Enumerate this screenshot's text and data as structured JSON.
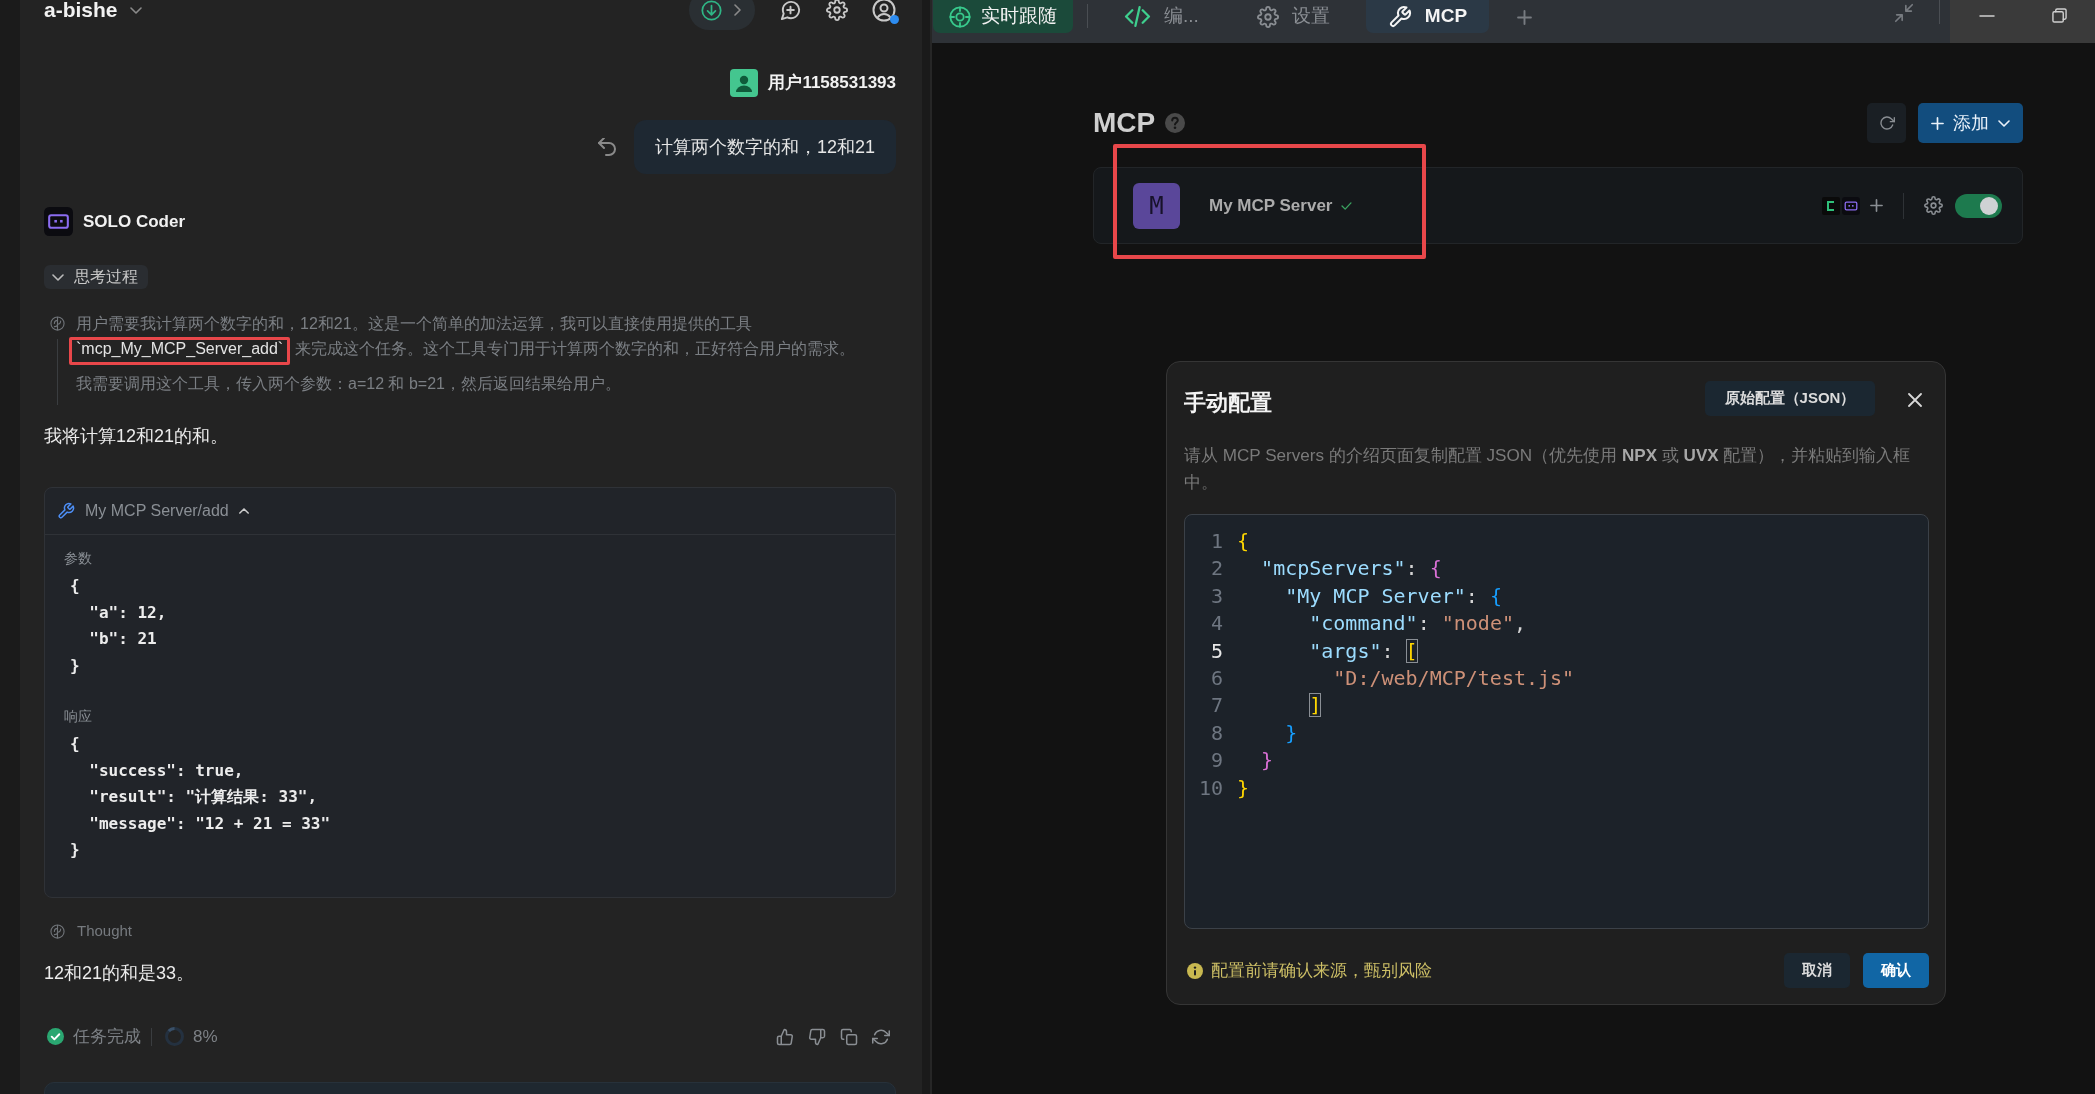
{
  "chat": {
    "project": "a-bishe",
    "user": {
      "name": "用户1158531393"
    },
    "user_message": "计算两个数字的和，12和21",
    "agent": {
      "name": "SOLO Coder"
    },
    "thinking": {
      "label": "思考过程",
      "expanded": true,
      "paragraphs": [
        {
          "segments": [
            {
              "kind": "text",
              "text": "用户需要我计算两个数字的和，12和21。这是一个简单的加法运算，我可以直接使用提供的工具 "
            },
            {
              "kind": "code",
              "text": "`mcp_My_MCP_Server_add`",
              "annotated": true
            },
            {
              "kind": "text",
              "text": " 来完成这个任务。这个工具专门用于计算两个数字的和，正好符合用户的需求。"
            }
          ]
        },
        {
          "segments": [
            {
              "kind": "text",
              "text": "我需要调用这个工具，传入两个参数：a=12 和 b=21，然后返回结果给用户。"
            }
          ]
        }
      ]
    },
    "items": [
      {
        "kind": "text",
        "text": "我将计算12和21的和。"
      },
      {
        "kind": "tool_call",
        "title": "My MCP Server/add",
        "expanded": true,
        "sections": [
          {
            "label": "参数",
            "lines": [
              "{",
              "  \"a\": 12,",
              "  \"b\": 21",
              "}"
            ]
          },
          {
            "label": "响应",
            "lines": [
              "{",
              "  \"success\": true,",
              "  \"result\": \"计算结果: 33\",",
              "  \"message\": \"12 + 21 = 33\"",
              "}"
            ]
          }
        ]
      },
      {
        "kind": "thought",
        "label": "Thought"
      },
      {
        "kind": "text",
        "text": "12和21的和是33。"
      }
    ],
    "status": {
      "label": "任务完成",
      "done": true
    },
    "context": {
      "reading": "8%"
    }
  },
  "follow_toggle": {
    "label": "实时跟随",
    "on": true
  },
  "tabs": [
    {
      "kind": "code",
      "label": "编...",
      "selected": false
    },
    {
      "kind": "settings",
      "label": "设置",
      "selected": false
    },
    {
      "kind": "tools",
      "label": "MCP",
      "selected": true
    }
  ],
  "mcp": {
    "title": "MCP",
    "add_button": "添加",
    "servers": [
      {
        "initial": "M",
        "name": "My MCP Server",
        "connected": true,
        "enabled": true,
        "annotated": true
      }
    ]
  },
  "dialog": {
    "title": "手动配置",
    "raw_button": "原始配置（JSON）",
    "description": "请从 MCP Servers 的介绍页面复制配置 JSON（优先使用 **NPX** 或 **UVX** 配置），并粘贴到输入框中。",
    "editor": {
      "lines": [
        {
          "number": "1",
          "current": false,
          "tokens": [
            {
              "kind": "open",
              "text": "{",
              "color": "#ffd700",
              "matched": false
            }
          ]
        },
        {
          "number": "2",
          "current": false,
          "tokens": [
            {
              "kind": "key",
              "text": "\"mcpServers\""
            },
            {
              "kind": "punct",
              "text": ": "
            },
            {
              "kind": "open",
              "text": "{",
              "color": "#da70d6",
              "matched": false
            }
          ]
        },
        {
          "number": "3",
          "current": false,
          "tokens": [
            {
              "kind": "key",
              "text": "\"My MCP Server\""
            },
            {
              "kind": "punct",
              "text": ": "
            },
            {
              "kind": "open",
              "text": "{",
              "color": "#179fff",
              "matched": false
            }
          ]
        },
        {
          "number": "4",
          "current": false,
          "tokens": [
            {
              "kind": "key",
              "text": "\"command\""
            },
            {
              "kind": "punct",
              "text": ": "
            },
            {
              "kind": "string",
              "text": "\"node\""
            },
            {
              "kind": "punct",
              "text": ","
            }
          ]
        },
        {
          "number": "5",
          "current": true,
          "tokens": [
            {
              "kind": "key",
              "text": "\"args\""
            },
            {
              "kind": "punct",
              "text": ": "
            },
            {
              "kind": "open",
              "text": "[",
              "color": "#ffd700",
              "matched": true
            }
          ]
        },
        {
          "number": "6",
          "current": false,
          "tokens": [
            {
              "kind": "string",
              "text": "\"D:/web/MCP/test.js\""
            }
          ]
        },
        {
          "number": "7",
          "current": false,
          "tokens": [
            {
              "kind": "close",
              "text": "]",
              "color": "#ffd700",
              "matched": true
            }
          ]
        },
        {
          "number": "8",
          "current": false,
          "tokens": [
            {
              "kind": "close",
              "text": "}",
              "color": "#179fff",
              "matched": false
            }
          ]
        },
        {
          "number": "9",
          "current": false,
          "tokens": [
            {
              "kind": "close",
              "text": "}",
              "color": "#da70d6",
              "matched": false
            }
          ]
        },
        {
          "number": "10",
          "current": false,
          "tokens": [
            {
              "kind": "close",
              "text": "}",
              "color": "#ffd700",
              "matched": false
            }
          ]
        }
      ]
    },
    "warning": "配置前请确认来源，甄别风险",
    "buttons": [
      {
        "kind": "secondary",
        "label": "取消"
      },
      {
        "kind": "primary",
        "label": "确认"
      }
    ]
  }
}
